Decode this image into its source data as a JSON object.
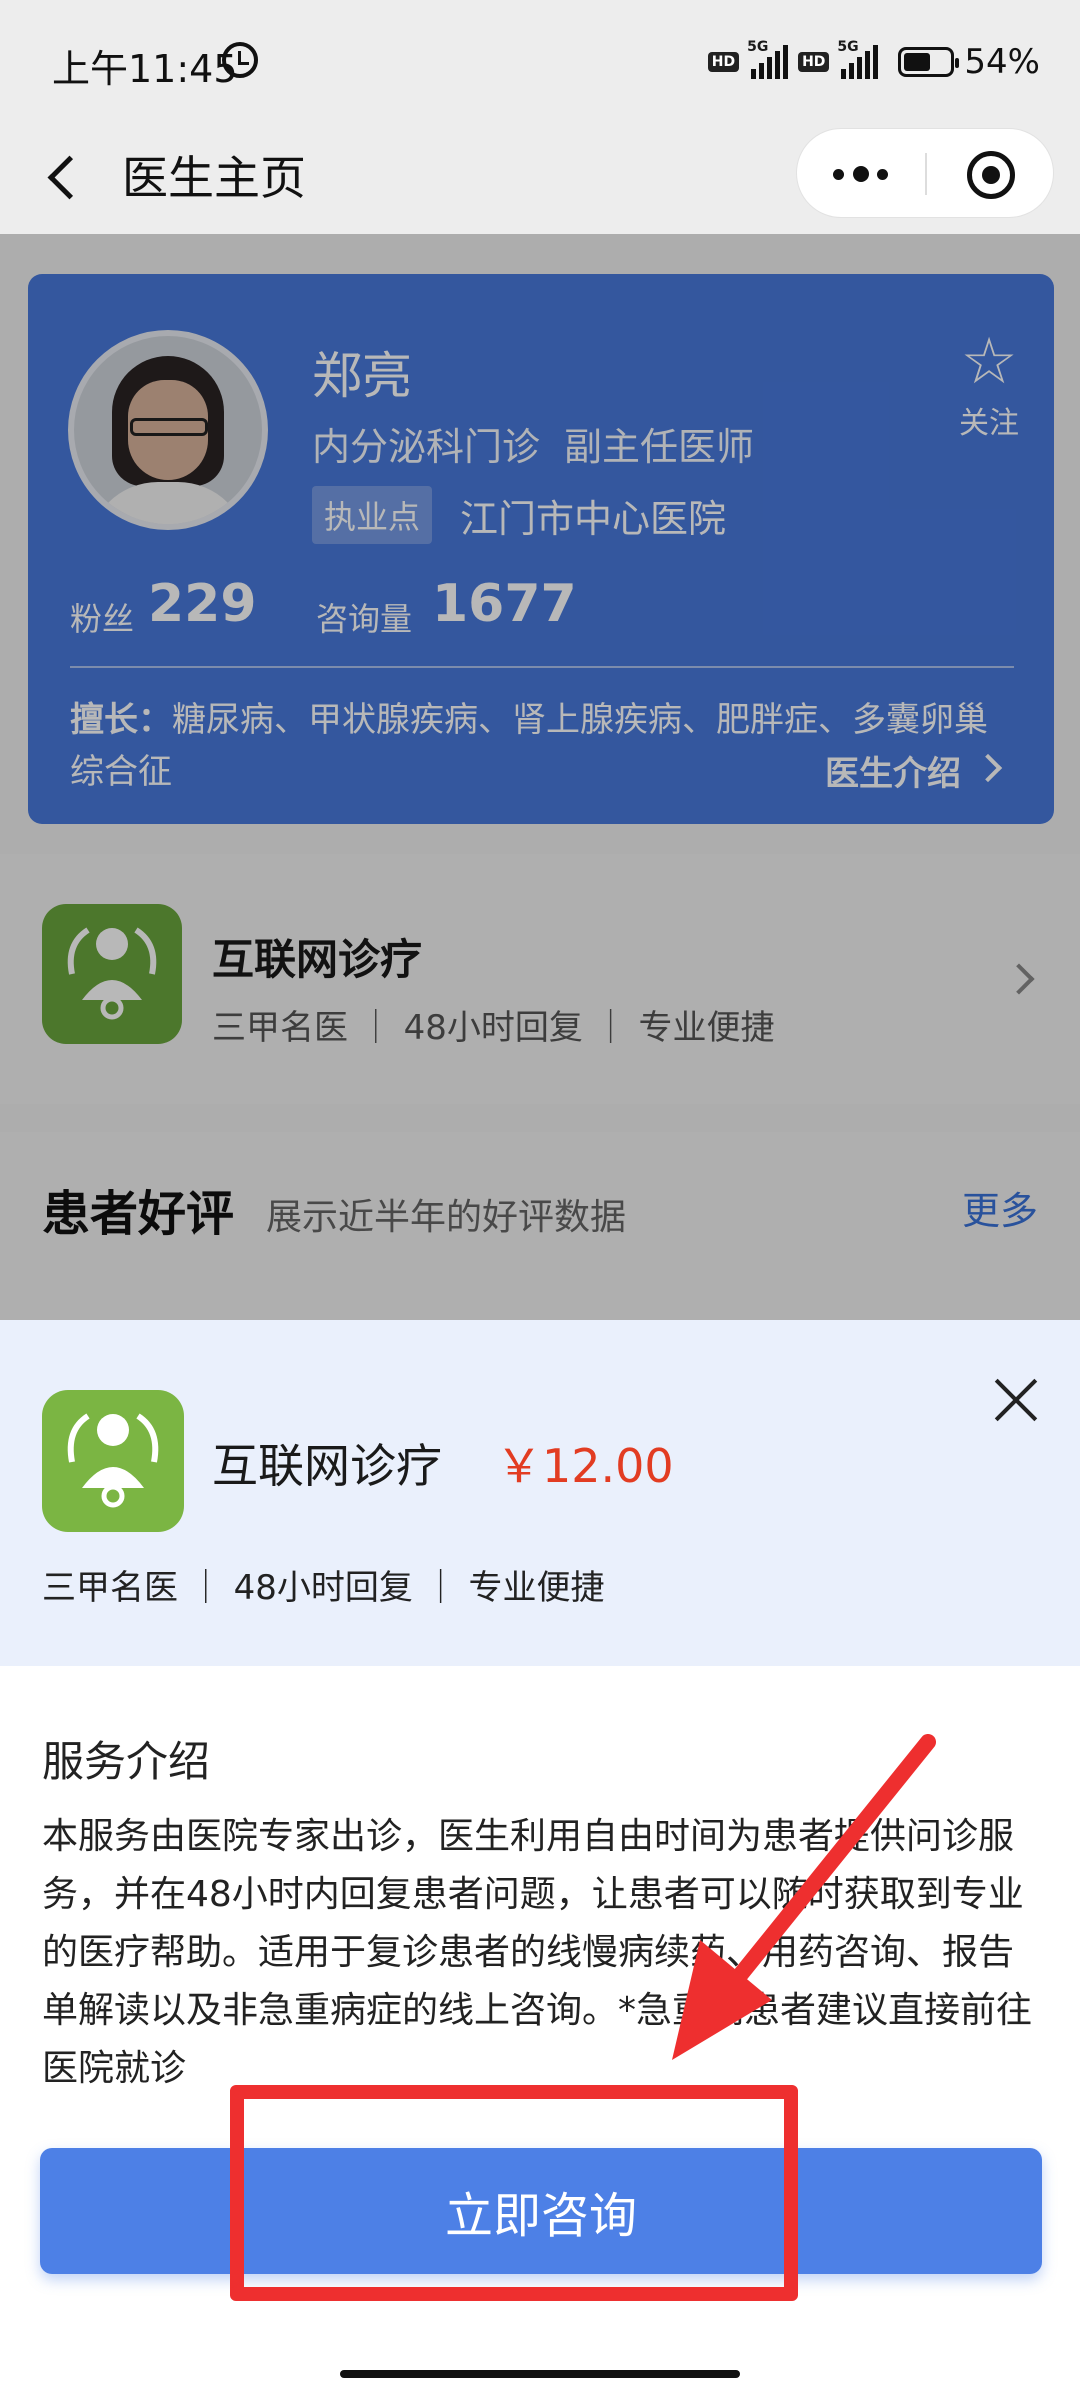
{
  "status_bar": {
    "time": "上午11:45",
    "network_badge_1": "HD",
    "network_type_1": "5G",
    "network_badge_2": "HD",
    "network_type_2": "5G",
    "battery": "54%"
  },
  "nav": {
    "title": "医生主页"
  },
  "doctor": {
    "name": "郑亮",
    "department": "内分泌科门诊",
    "title": "副主任医师",
    "hospital_tag": "执业点",
    "hospital": "江门市中心医院",
    "follow_label": "关注",
    "fans_label": "粉丝",
    "fans_count": "229",
    "consult_label": "咨询量",
    "consult_count": "1677",
    "specialty_label": "擅长：",
    "specialty_text": "糖尿病、甲状腺疾病、肾上腺疾病、肥胖症、多囊卵巢综合征",
    "intro_link": "医生介绍"
  },
  "service_row": {
    "name": "互联网诊疗",
    "tags": "三甲名医 ｜ 48小时回复 ｜ 专业便捷"
  },
  "review": {
    "title": "患者好评",
    "subtitle": "展示近半年的好评数据",
    "more": "更多"
  },
  "sheet": {
    "service_name": "互联网诊疗",
    "price": "￥12.00",
    "tags": "三甲名医 ｜ 48小时回复 ｜ 专业便捷",
    "intro_title": "服务介绍",
    "intro_text": "本服务由医院专家出诊，医生利用自由时间为患者提供问诊服务，并在48小时内回复患者问题，让患者可以随时获取到专业的医疗帮助。适用于复诊患者的线慢病续药、用药咨询、报告单解读以及非急重病症的线上咨询。*急重病患者建议直接前往医院就诊",
    "cta_label": "立即咨询"
  },
  "colors": {
    "card_blue": "#4879dc",
    "cta_blue": "#4d80e6",
    "price_red": "#e23c22",
    "annotation_red": "#ee2f2f",
    "icon_green": "#7bb543"
  }
}
